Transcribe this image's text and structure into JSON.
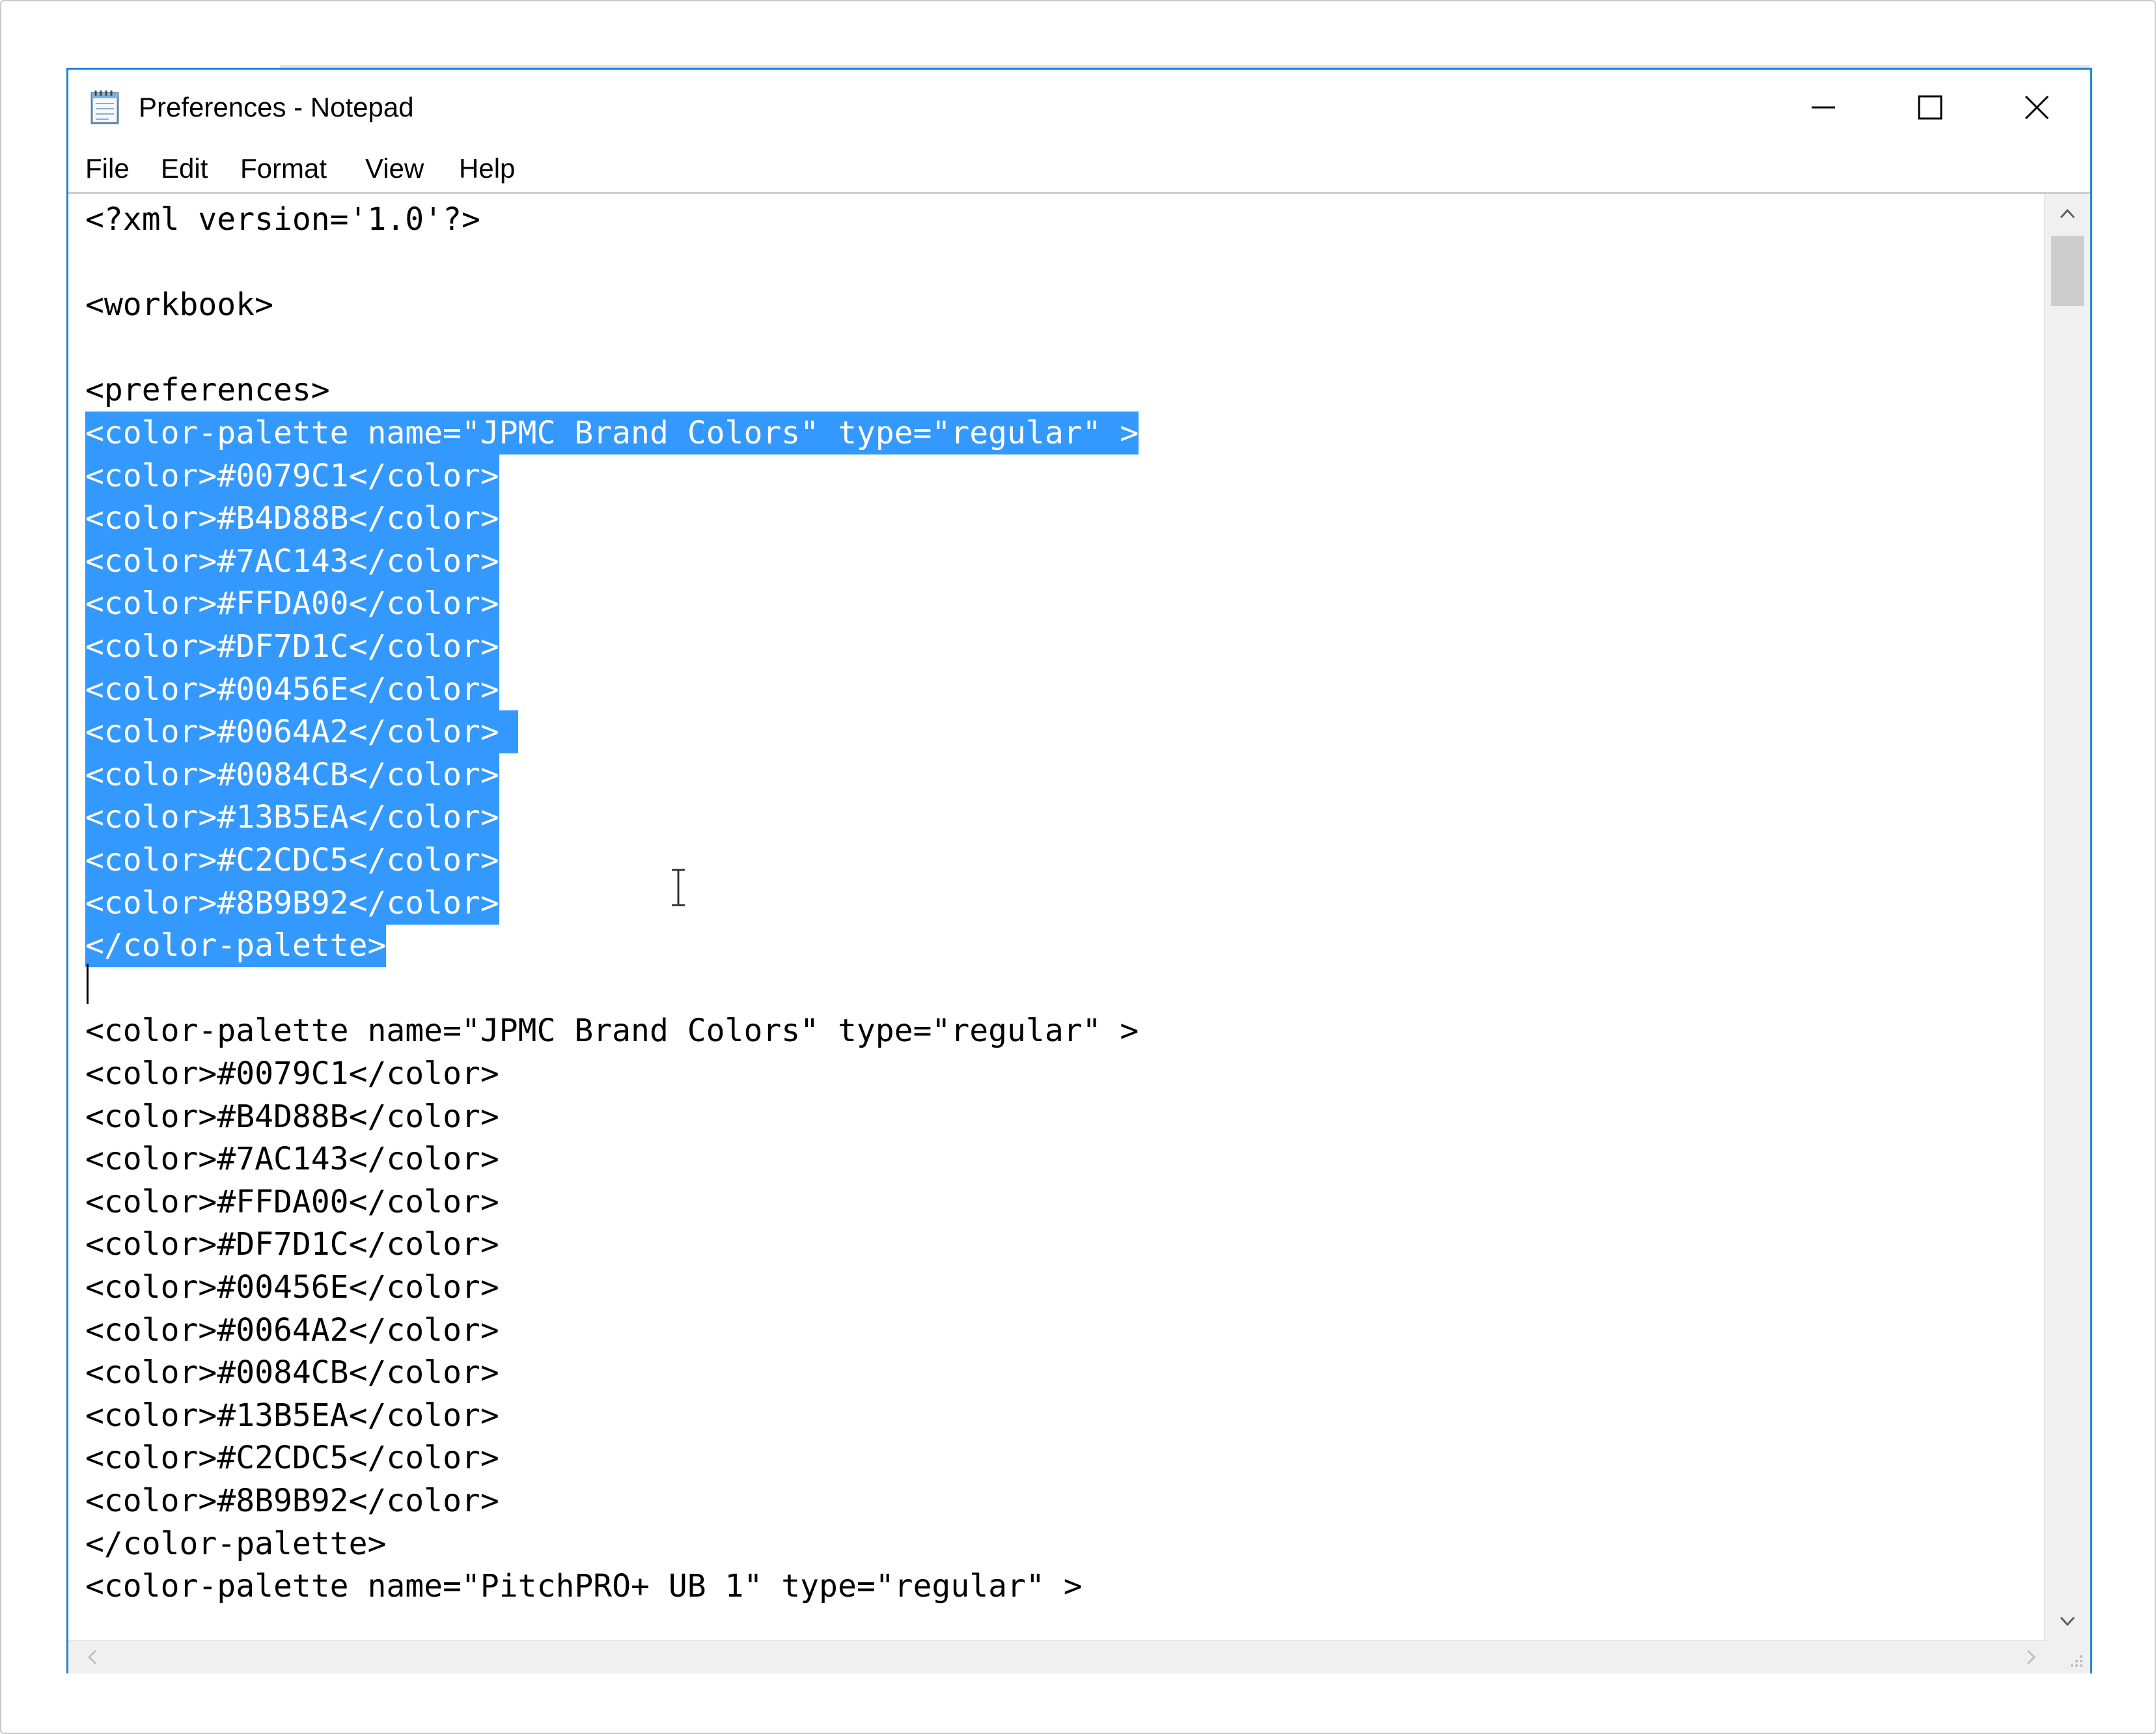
{
  "window": {
    "title": "Preferences - Notepad"
  },
  "menu": [
    "File",
    "Edit",
    "Format",
    "View",
    "Help"
  ],
  "editor": {
    "selected_lines": [
      3,
      4,
      5,
      6,
      7,
      8,
      9,
      10,
      11,
      12,
      13,
      14,
      15
    ],
    "lines": [
      "<?xml version='1.0'?>",
      "",
      "<workbook>",
      "",
      "<preferences>",
      "<color-palette name=\"JPMC Brand Colors\" type=\"regular\" >",
      "<color>#0079C1</color>",
      "<color>#B4D88B</color>",
      "<color>#7AC143</color>",
      "<color>#FFDA00</color>",
      "<color>#DF7D1C</color>",
      "<color>#00456E</color>",
      "<color>#0064A2</color> ",
      "<color>#0084CB</color>",
      "<color>#13B5EA</color>",
      "<color>#C2CDC5</color>",
      "<color>#8B9B92</color>",
      "</color-palette>",
      "",
      "<color-palette name=\"JPMC Brand Colors\" type=\"regular\" >",
      "<color>#0079C1</color>",
      "<color>#B4D88B</color>",
      "<color>#7AC143</color>",
      "<color>#FFDA00</color>",
      "<color>#DF7D1C</color>",
      "<color>#00456E</color>",
      "<color>#0064A2</color>",
      "<color>#0084CB</color>",
      "<color>#13B5EA</color>",
      "<color>#C2CDC5</color>",
      "<color>#8B9B92</color>",
      "</color-palette>",
      "<color-palette name=\"PitchPRO+ UB 1\" type=\"regular\" >"
    ]
  },
  "colors": {
    "selection": "#3399FF",
    "window_border": "#1883D7",
    "scrollbar": "#F0F0F0"
  },
  "icons": {
    "app": "notepad-icon",
    "minimize": "minimize-icon",
    "maximize": "maximize-icon",
    "close": "close-icon"
  }
}
